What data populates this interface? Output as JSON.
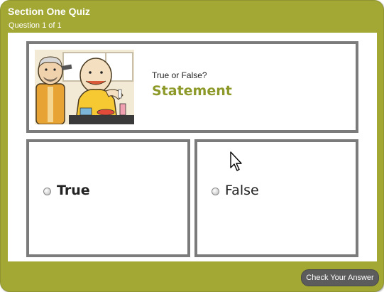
{
  "window": {
    "title": "Section One Quiz",
    "progress": "Question 1 of 1"
  },
  "question": {
    "prompt": "True or False?",
    "statement": "Statement",
    "illustration_icon": "cartoon-train-passengers-image"
  },
  "answers": [
    {
      "label": "True",
      "selected": false
    },
    {
      "label": "False",
      "selected": false
    }
  ],
  "footer": {
    "check_label": "Check Your Answer"
  },
  "colors": {
    "frame": "#a3a835",
    "accent_text": "#8d9a2a",
    "box_border": "#7b7b7b",
    "button": "#5c5c5c"
  }
}
